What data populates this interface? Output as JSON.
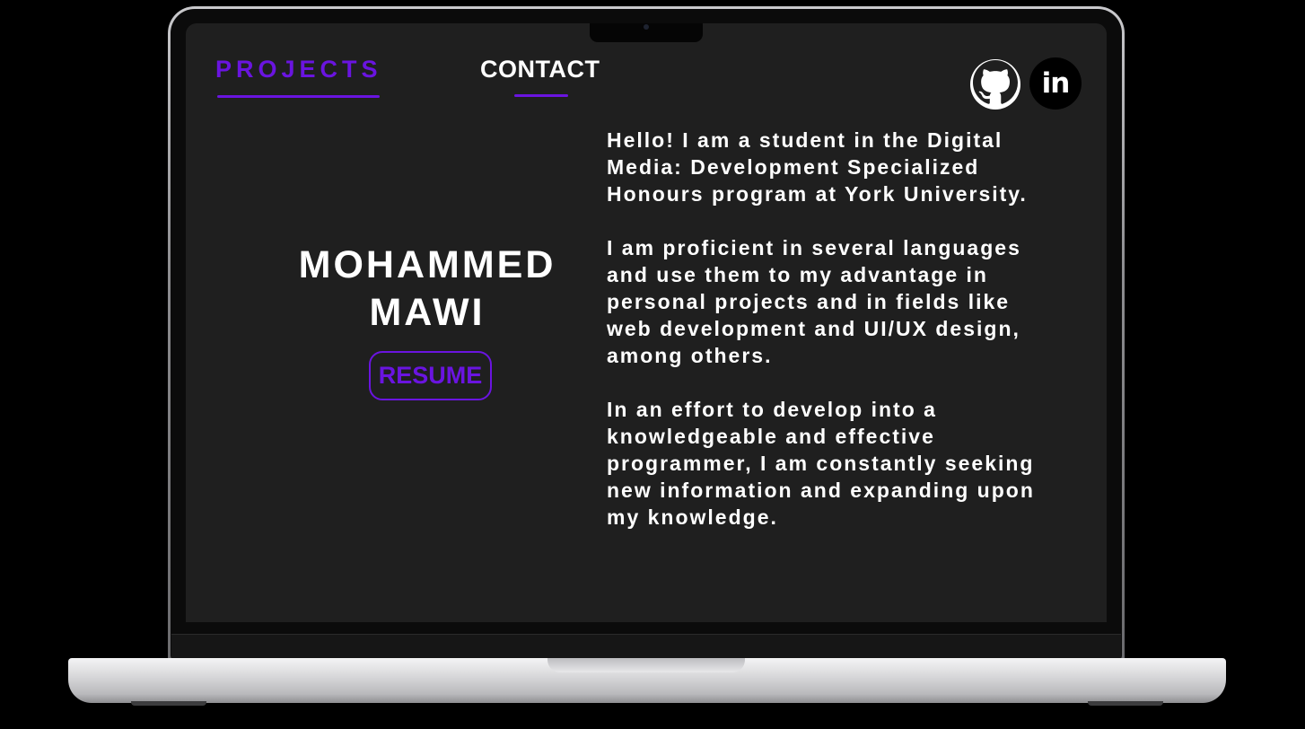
{
  "nav": {
    "projects_label": "PROJECTS",
    "contact_label": "CONTACT"
  },
  "social": {
    "github_icon": "github-icon",
    "linkedin_icon": "linkedin-icon",
    "linkedin_text": "in"
  },
  "hero": {
    "name_line1": "MOHAMMED",
    "name_line2": "MAWI",
    "resume_label": "RESUME"
  },
  "bio": {
    "paragraph1": "Hello! I am a student in the Digital Media: Development Specialized Honours program at York University.",
    "paragraph2": "I am proficient in several languages and use them to my advantage in personal projects and in fields like web development and UI/UX design, among others.",
    "paragraph3": "In an effort to develop into a knowledgeable and effective programmer, I am constantly seeking new information and expanding upon my knowledge."
  },
  "colors": {
    "accent": "#6a14e0",
    "screen_bg": "#1f1f1f",
    "text": "#ffffff"
  }
}
